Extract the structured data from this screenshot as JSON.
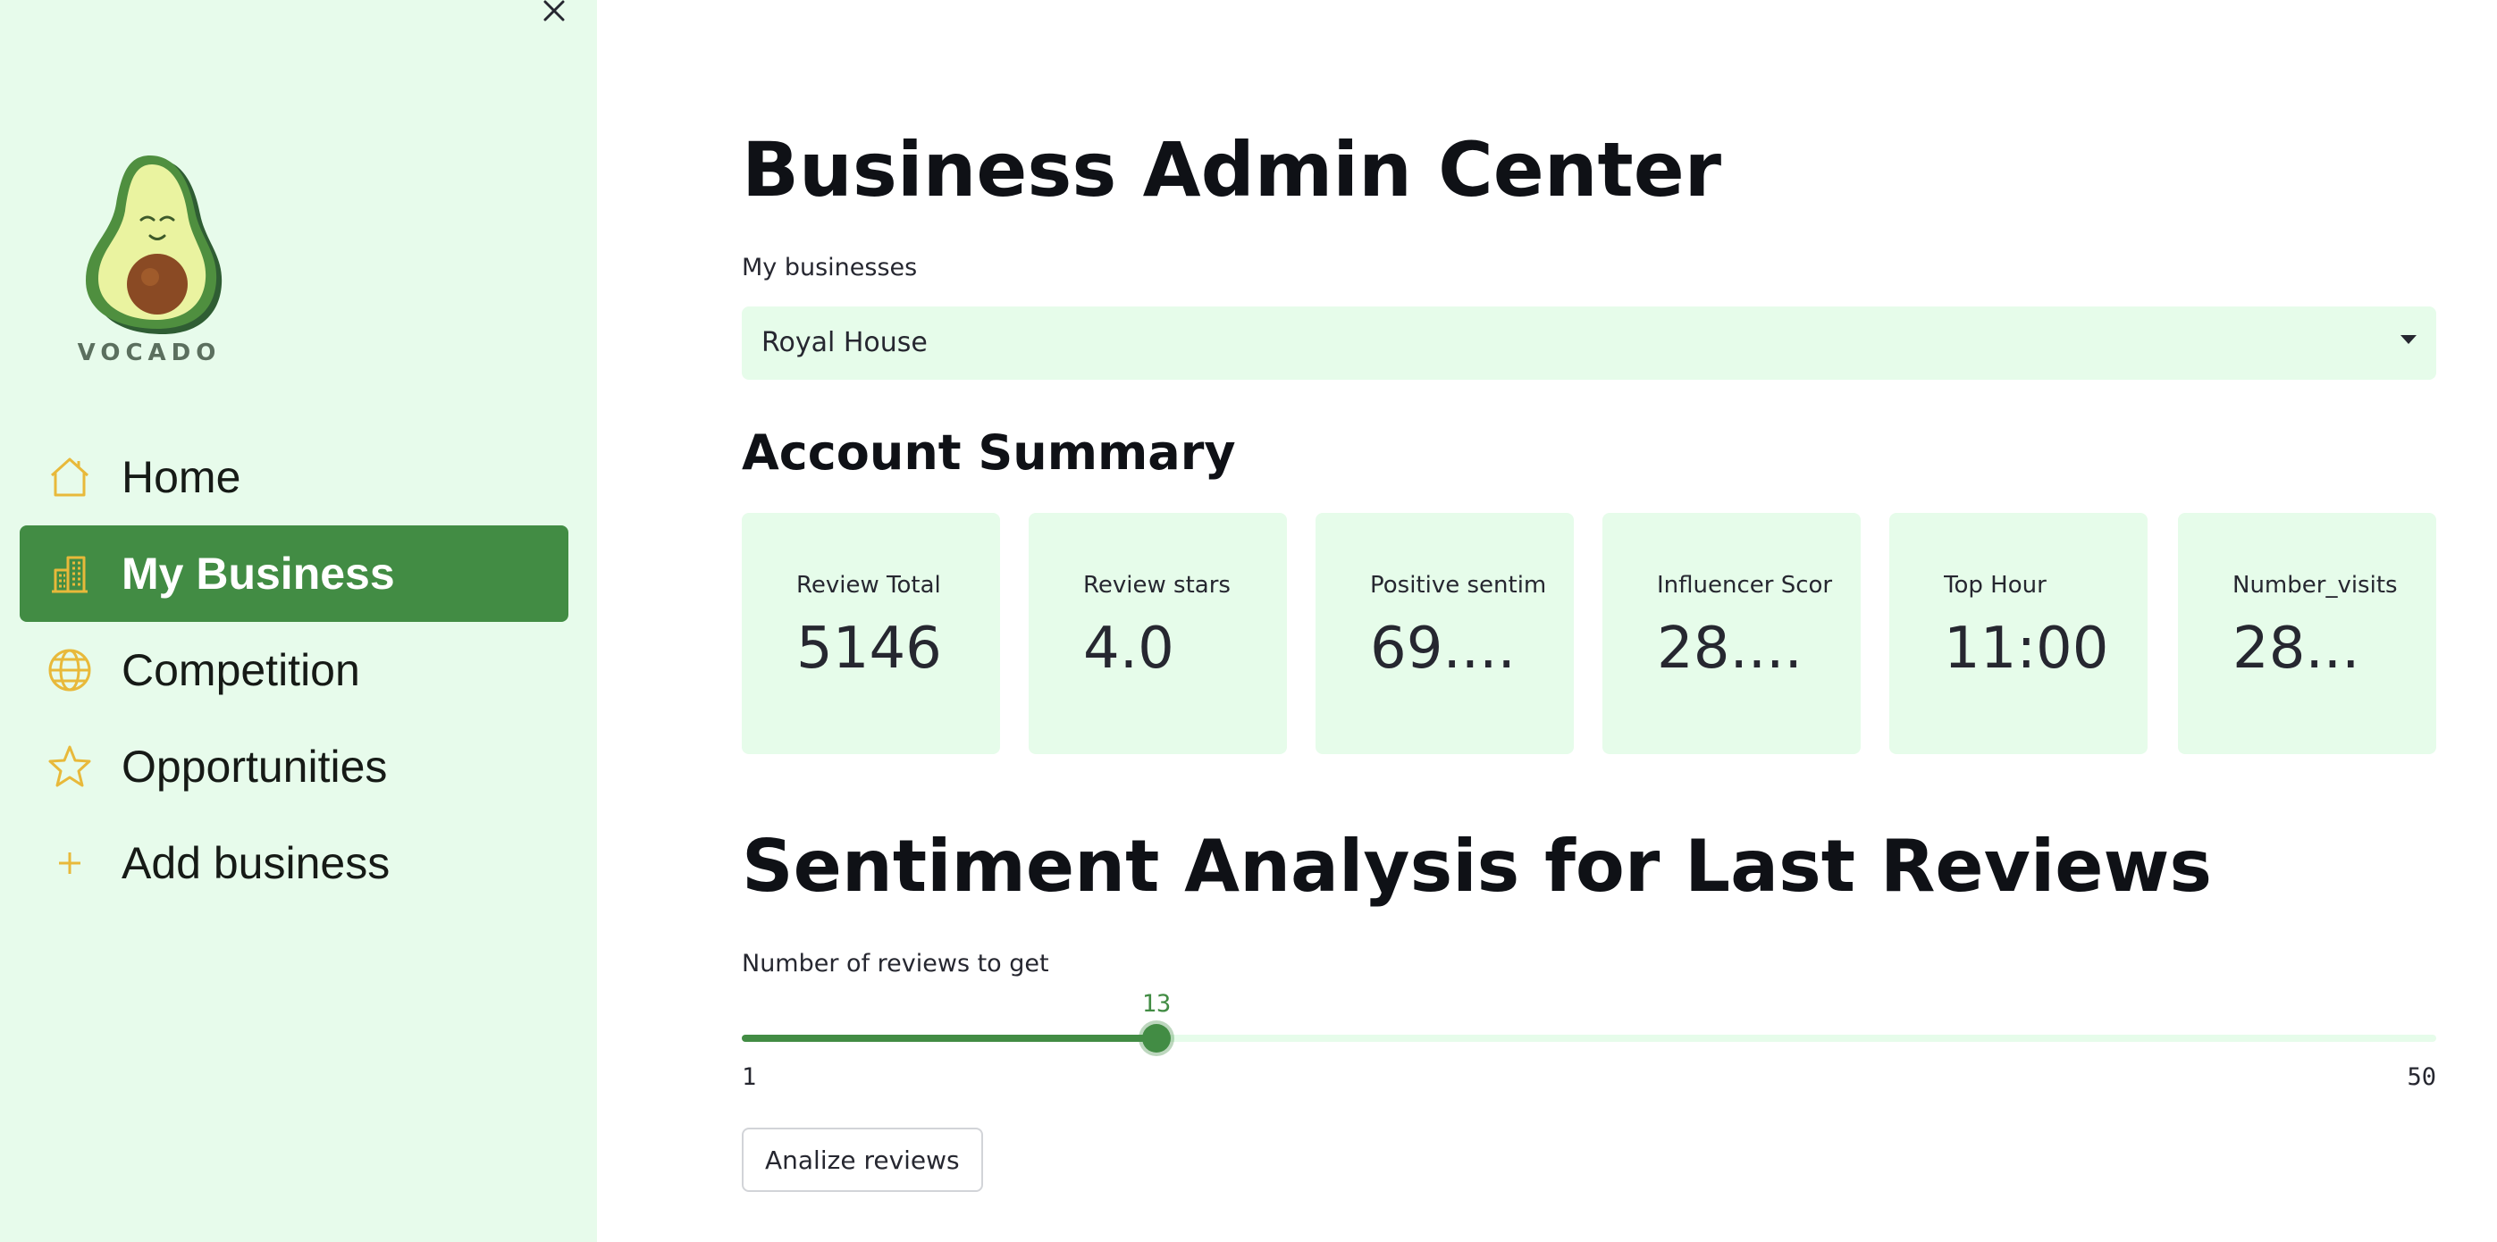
{
  "sidebar": {
    "logo_text": "VOCADO",
    "nav": [
      {
        "label": "Home",
        "icon": "house-icon",
        "active": false
      },
      {
        "label": "My Business",
        "icon": "buildings-icon",
        "active": true
      },
      {
        "label": "Competition",
        "icon": "globe-icon",
        "active": false
      },
      {
        "label": "Opportunities",
        "icon": "star-icon",
        "active": false
      },
      {
        "label": "Add business",
        "icon": "plus-icon",
        "active": false
      }
    ]
  },
  "main": {
    "title": "Business Admin Center",
    "business_select": {
      "label": "My businesses",
      "value": "Royal House"
    },
    "account_summary": {
      "title": "Account Summary",
      "metrics": [
        {
          "label": "Review Total",
          "value": "5146"
        },
        {
          "label": "Review stars",
          "value": "4.0"
        },
        {
          "label": "Positive sentim",
          "value": "69...."
        },
        {
          "label": "Influencer Scor",
          "value": "28...."
        },
        {
          "label": "Top Hour",
          "value": "11:00"
        },
        {
          "label": "Number_visits",
          "value": "28..."
        }
      ]
    },
    "sentiment": {
      "title": "Sentiment Analysis for Last Reviews",
      "slider": {
        "label": "Number of reviews to get",
        "value": 13,
        "min": 1,
        "max": 50
      },
      "button_label": "Analize reviews"
    }
  },
  "colors": {
    "sidebar_bg": "#e7fbeb",
    "accent": "#428c44",
    "card_bg": "#e6fcea",
    "icon": "#e8b93a"
  }
}
